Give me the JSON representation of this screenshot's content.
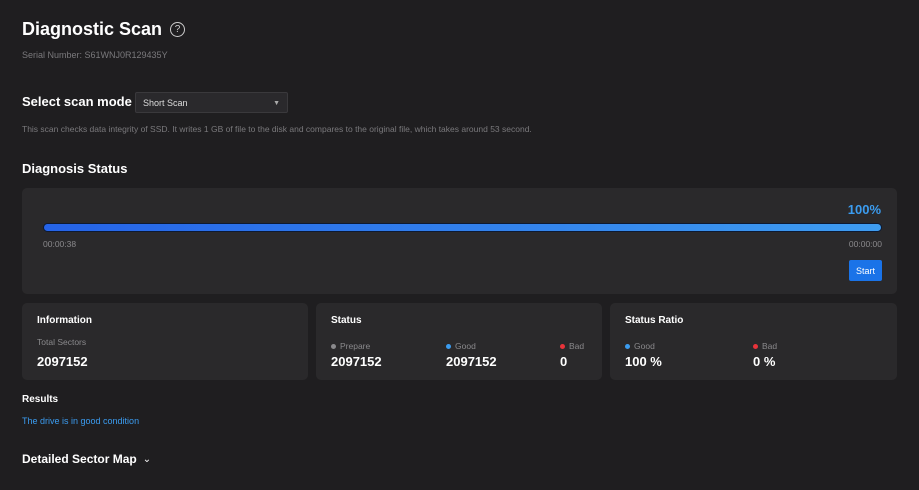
{
  "header": {
    "title": "Diagnostic Scan",
    "help_icon": "?",
    "serial": "Serial Number: S61WNJ0R129435Y"
  },
  "scan_mode": {
    "label": "Select scan mode",
    "selected": "Short Scan",
    "description": "This scan checks data integrity of SSD. It writes 1 GB of file to the disk and compares to the original file, which takes around 53 second."
  },
  "diagnosis": {
    "title": "Diagnosis Status",
    "percent_label": "100%",
    "progress": 100,
    "elapsed": "00:00:38",
    "remaining": "00:00:00",
    "start_label": "Start"
  },
  "information": {
    "title": "Information",
    "label": "Total Sectors",
    "value": "2097152"
  },
  "status": {
    "title": "Status",
    "items": [
      {
        "label": "Prepare",
        "value": "2097152",
        "color": "#8a898c"
      },
      {
        "label": "Good",
        "value": "2097152",
        "color": "#3b9cf0"
      },
      {
        "label": "Bad",
        "value": "0",
        "color": "#e8333a"
      }
    ]
  },
  "ratio": {
    "title": "Status Ratio",
    "items": [
      {
        "label": "Good",
        "value": "100 %",
        "color": "#3b9cf0"
      },
      {
        "label": "Bad",
        "value": "0 %",
        "color": "#e8333a"
      }
    ]
  },
  "results": {
    "title": "Results",
    "message": "The drive is in good condition"
  },
  "sector_map": {
    "label": "Detailed Sector Map"
  }
}
